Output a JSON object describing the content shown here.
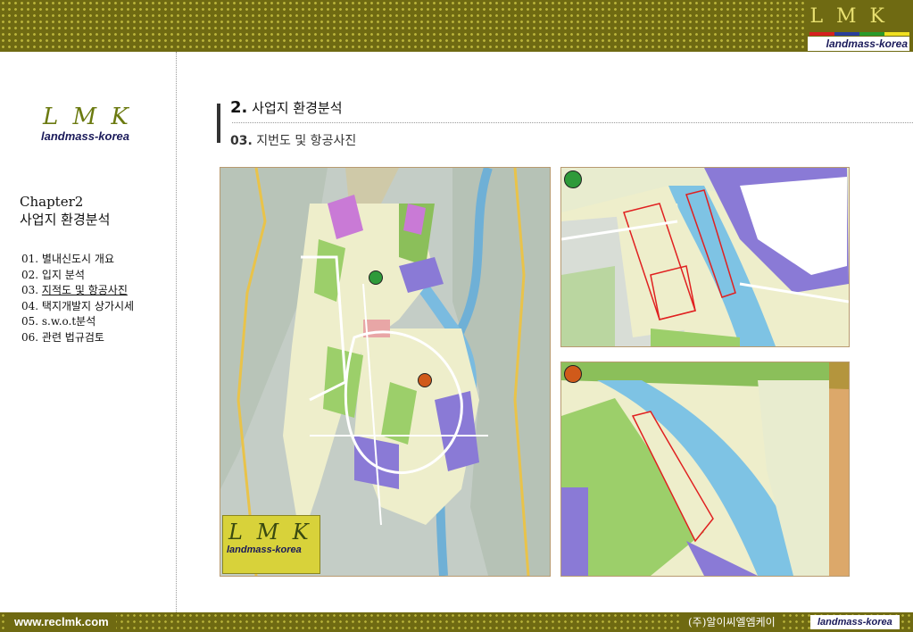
{
  "header": {
    "logo_text": "L M K",
    "logo_sub": "landmass-korea",
    "strip_colors": [
      "#d62020",
      "#2a3f9a",
      "#2a9a2a",
      "#f0e020"
    ]
  },
  "sidebar": {
    "logo_text": "L M K",
    "logo_sub": "landmass-korea",
    "chapter_label": "Chapter2",
    "chapter_title": "사업지 환경분석",
    "items": [
      {
        "label": "01. 별내신도시 개요"
      },
      {
        "label": "02. 입지 분석"
      },
      {
        "label": "03. 지적도 및 항공사진",
        "prefix": "03. ",
        "text": "지적도 및 항공사진"
      },
      {
        "label": "04. 택지개발지 상가시세"
      },
      {
        "label": "05. s.w.o.t분석"
      },
      {
        "label": "06. 관련 법규검토"
      }
    ]
  },
  "content": {
    "title_num": "2.",
    "title_text": "사업지 환경분석",
    "subtitle_num": "03.",
    "subtitle_text": "지번도 및 항공사진",
    "map_logo_text": "L M K",
    "map_logo_sub": "landmass-korea",
    "pin_green": "#2e9a3a",
    "pin_orange": "#d05a1a"
  },
  "footer": {
    "url": "www.reclmk.com",
    "company": "(주)알이씨엘엠케이",
    "company_sub": "landmass-korea"
  }
}
